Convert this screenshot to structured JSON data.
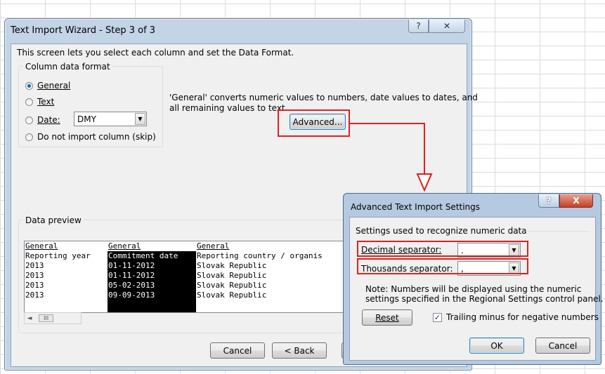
{
  "wizard": {
    "title": "Text Import Wizard - Step 3 of 3",
    "help_label": "?",
    "close_label": "✕",
    "intro": "This screen lets you select each column and set the Data Format.",
    "format_group_label": "Column data format",
    "options": {
      "general": "General",
      "text": "Text",
      "date": "Date:",
      "skip": "Do not import column (skip)"
    },
    "date_value": "DMY",
    "description_line1": "'General' converts numeric values to numbers, date values to dates, and",
    "description_line2": "all remaining values to text.",
    "advanced_button": "Advanced...",
    "preview_label": "Data preview",
    "preview_columns": [
      {
        "header": "General",
        "cells": [
          "Reporting year",
          "2013",
          "2013",
          "2013",
          "2013"
        ]
      },
      {
        "header": "General",
        "cells": [
          "Commitment date",
          "01-11-2012",
          "01-11-2012",
          "05-02-2013",
          "09-09-2013"
        ]
      },
      {
        "header": "General",
        "cells": [
          "Reporting country / organis",
          "Slovak Republic",
          "Slovak Republic",
          "Slovak Republic",
          "Slovak Republic"
        ]
      }
    ],
    "scroll_thumb": "III",
    "cancel_button": "Cancel",
    "back_button": "< Back"
  },
  "advanced": {
    "title": "Advanced Text Import Settings",
    "help_label": "?",
    "close_label": "X",
    "group_label": "Settings used to recognize numeric data",
    "decimal_label": "Decimal separator:",
    "decimal_value": ".",
    "thousands_label": "Thousands separator:",
    "thousands_value": ",",
    "note_line1": "Note: Numbers will be displayed using the numeric",
    "note_line2": "settings specified in the Regional Settings control panel.",
    "reset_button": "Reset",
    "trailing_minus_label": "Trailing minus for negative numbers",
    "trailing_minus_checked": true,
    "ok_button": "OK",
    "cancel_button": "Cancel"
  },
  "colors": {
    "highlight": "#e02020",
    "title_bar": "#c3d4e7",
    "dialog_bg": "#f0f0f0"
  }
}
